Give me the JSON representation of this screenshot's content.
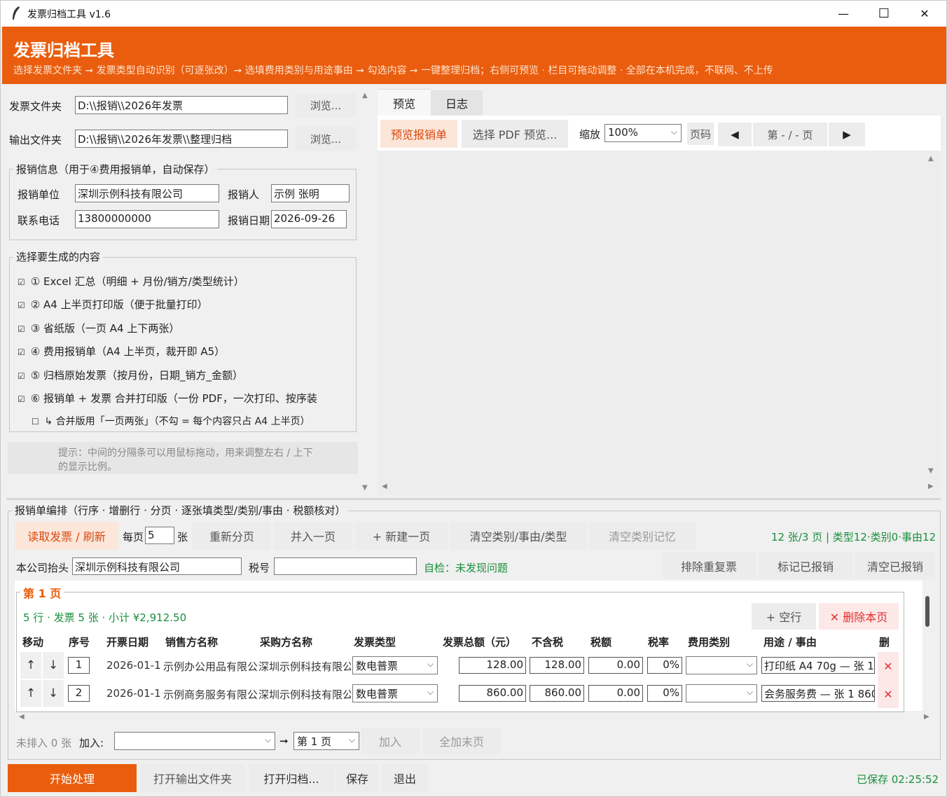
{
  "window": {
    "title": "发票归档工具 v1.6",
    "minimize": "—",
    "maximize": "☐",
    "close": "✕"
  },
  "header": {
    "title": "发票归档工具",
    "subtitle": "选择发票文件夹 ➞ 发票类型自动识别（可逐张改）➞ 选填费用类别与用途事由 ➞ 勾选内容 ➞ 一键整理归档；右侧可预览 · 栏目可拖动调整 · 全部在本机完成，不联网、不上传"
  },
  "folders": {
    "invoice_label": "发票文件夹",
    "invoice_value": "D:\\\\报销\\\\2026年发票",
    "browse1": "浏览...",
    "output_label": "输出文件夹",
    "output_value": "D:\\\\报销\\\\2026年发票\\\\整理归档",
    "browse2": "浏览..."
  },
  "reimburse": {
    "group_title": "报销信息（用于④费用报销单，自动保存）",
    "unit_label": "报销单位",
    "unit_value": "深圳示例科技有限公司",
    "person_label": "报销人",
    "person_value": "示例 张明",
    "phone_label": "联系电话",
    "phone_value": "13800000000",
    "date_label": "报销日期",
    "date_value": "2026-09-26"
  },
  "content": {
    "group_title": "选择要生成的内容",
    "check_mark": "☑",
    "uncheck_mark": "☐",
    "items": [
      "① Excel 汇总（明细 + 月份/销方/类型统计）",
      "② A4 上半页打印版（便于批量打印）",
      "③ 省纸版（一页 A4 上下两张）",
      "④ 费用报销单（A4 上半页，裁开即 A5）",
      "⑤ 归档原始发票（按月份，日期_销方_金额）",
      "⑥ 报销单 + 发票 合并打印版（一份 PDF，一次打印、按序装"
    ],
    "sub_item": "↳ 合并版用「一页两张」（不勾 = 每个内容只占 A4 上半页）"
  },
  "tip": "提示：中间的分隔条可以用鼠标拖动，用来调整左右 / 上下的显示比例。",
  "preview": {
    "tab_preview": "预览",
    "tab_log": "日志",
    "btn_preview_form": "预览报销单",
    "btn_pick_pdf": "选择 PDF 预览...",
    "zoom_label": "缩放",
    "zoom_value": "100%",
    "page_label": "页码",
    "prev": "◀",
    "page_value": "第 - / - 页",
    "next": "▶"
  },
  "editor": {
    "group_title": "报销单编排（行序 · 增删行 · 分页 · 逐张填类型/类别/事由 · 税额核对）",
    "btn_read": "读取发票 / 刷新",
    "per_page_label": "每页",
    "per_page_value": "5",
    "per_page_unit": "张",
    "btn_repaginate": "重新分页",
    "btn_merge": "并入一页",
    "btn_new_page": "+ 新建一页",
    "btn_clear": "清空类别/事由/类型",
    "btn_clear_memory": "清空类别记忆",
    "summary": "12 张/3 页 | 类型12·类别0·事由12",
    "company_label": "本公司抬头",
    "company_value": "深圳示例科技有限公司",
    "tax_label": "税号",
    "tax_value": "",
    "selfcheck": "自检：未发现问题",
    "btn_dedupe": "排除重复票",
    "btn_mark": "标记已报销",
    "btn_clear_done": "清空已报销",
    "page_title": "第 1 页",
    "page_info": "5 行 · 发票 5 张 · 小计 ¥2,912.50",
    "btn_empty_row": "+ 空行",
    "btn_delete_page": "✕ 删除本页",
    "columns": [
      "移动",
      "序号",
      "开票日期",
      "销售方名称",
      "采购方名称",
      "发票类型",
      "发票总额（元）",
      "不含税",
      "税额",
      "税率",
      "费用类别",
      "用途 / 事由",
      "删"
    ],
    "rows": [
      {
        "seq": "1",
        "date": "2026-01-1",
        "seller": "示例办公用品有限公",
        "buyer": "深圳示例科技有限公",
        "type": "数电普票",
        "total": "128.00",
        "net": "128.00",
        "tax": "0.00",
        "rate": "0%",
        "category": "",
        "purpose": "打印纸 A4 70g — 张 1"
      },
      {
        "seq": "2",
        "date": "2026-01-1",
        "seller": "示例商务服务有限公",
        "buyer": "深圳示例科技有限公",
        "type": "数电普票",
        "total": "860.00",
        "net": "860.00",
        "tax": "0.00",
        "rate": "0%",
        "category": "",
        "purpose": "会务服务费 — 张 1 860"
      }
    ],
    "up": "↑",
    "down": "↓",
    "del": "✕",
    "unassigned": "未排入 0 张",
    "add_label": "加入:",
    "add_value": "",
    "arrow": "➞",
    "target_page": "第 1 页",
    "btn_add": "加入",
    "btn_add_all": "全加末页"
  },
  "footer": {
    "btn_start": "开始处理",
    "btn_open_output": "打开输出文件夹",
    "btn_open_archive": "打开归档...",
    "btn_save": "保存",
    "btn_exit": "退出",
    "saved": "已保存 02:25:52"
  },
  "colors": {
    "accent": "#ea5d0e",
    "green": "#1a8f3c",
    "danger": "#e03131"
  }
}
